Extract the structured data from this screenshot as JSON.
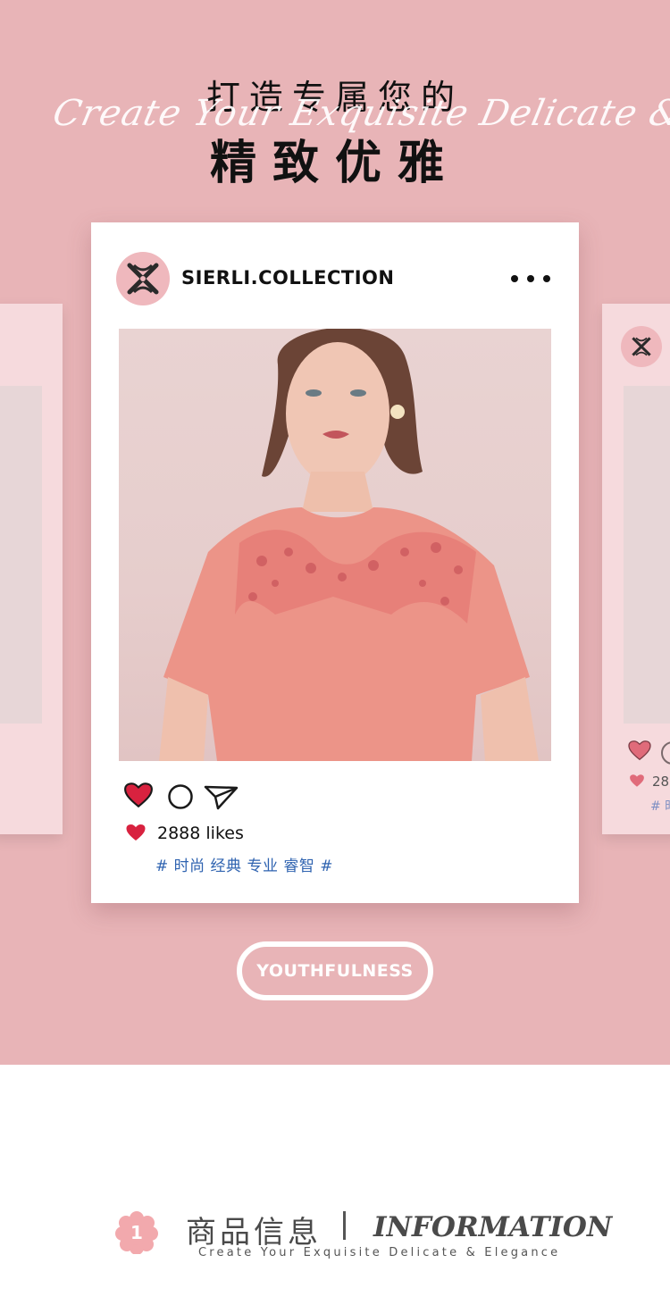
{
  "headline": {
    "line1": "打造专属您的",
    "script": "Create Your Exquisite Delicate & Elegance",
    "line2": "精致优雅"
  },
  "post": {
    "username": "SIERLI.COLLECTION",
    "photo_alt": "",
    "likes": "2888 likes",
    "hashtags": "# 时尚 经典 专业 睿智 #"
  },
  "side_card": {
    "likes_partial": "28",
    "tag_partial": "# 时"
  },
  "cta": {
    "label": "YOUTHFULNESS"
  },
  "info": {
    "number": "1",
    "title_cn": "商品信息",
    "title_en": "INFORMATION",
    "subtitle": "Create Your Exquisite Delicate & Elegance"
  },
  "colors": {
    "background_pink": "#e8b4b7",
    "heart_red": "#d8223f",
    "hashtag_blue": "#2f63b0",
    "avatar_pink": "#efb8bd"
  },
  "icons": {
    "more": "more-dots-icon",
    "like": "heart-icon",
    "comment": "comment-circle-icon",
    "share": "send-icon"
  }
}
